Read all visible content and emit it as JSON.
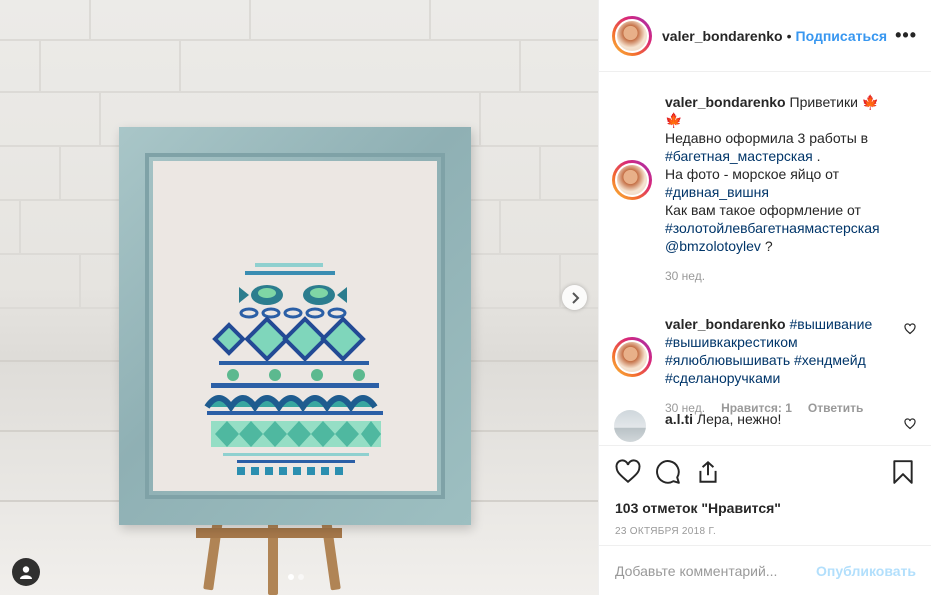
{
  "post": {
    "author": "valer_bondarenko",
    "follow_label": "Подписаться",
    "more_label": "•••",
    "separator": "•"
  },
  "caption": {
    "username": "valer_bondarenko",
    "line1": "Приветики",
    "emoji": "🍁🍁",
    "line2": "Недавно оформила 3 работы в",
    "tag1": "#багетная_мастерская",
    "tag1_after": ".",
    "line3": "На фото - морское яйцо от",
    "tag2": "#дивная_вишня",
    "line4": "Как вам такое оформление от",
    "tag3": "#золотойлевбагетнаямастерская",
    "mention": "@bmzolotoylev",
    "mention_after": "?",
    "time": "30 нед."
  },
  "comments": [
    {
      "username": "valer_bondarenko",
      "tags": [
        "#вышивание",
        "#вышивкакрестиком",
        "#ялюблювышивать",
        "#хендмейд",
        "#сделанoручками"
      ],
      "time": "30 нед.",
      "likes": "Нравится: 1",
      "reply": "Ответить"
    },
    {
      "username": "a.l.ti",
      "text": "Лера, нежно!"
    }
  ],
  "actions": {
    "likes_count": "103 отметок \"Нравится\"",
    "date": "23 ОКТЯБРЯ 2018 Г."
  },
  "add_comment": {
    "placeholder": "Добавьте комментарий...",
    "publish": "Опубликовать"
  },
  "carousel": {
    "slides": 2,
    "active": 1
  },
  "colors": {
    "link": "#003569",
    "follow": "#3897f0",
    "meta": "#999999",
    "publish_disabled": "#b2dffc"
  },
  "icons": [
    "heart-icon",
    "comment-icon",
    "share-icon",
    "bookmark-icon",
    "more-icon",
    "chevron-right-icon",
    "user-tag-icon"
  ]
}
